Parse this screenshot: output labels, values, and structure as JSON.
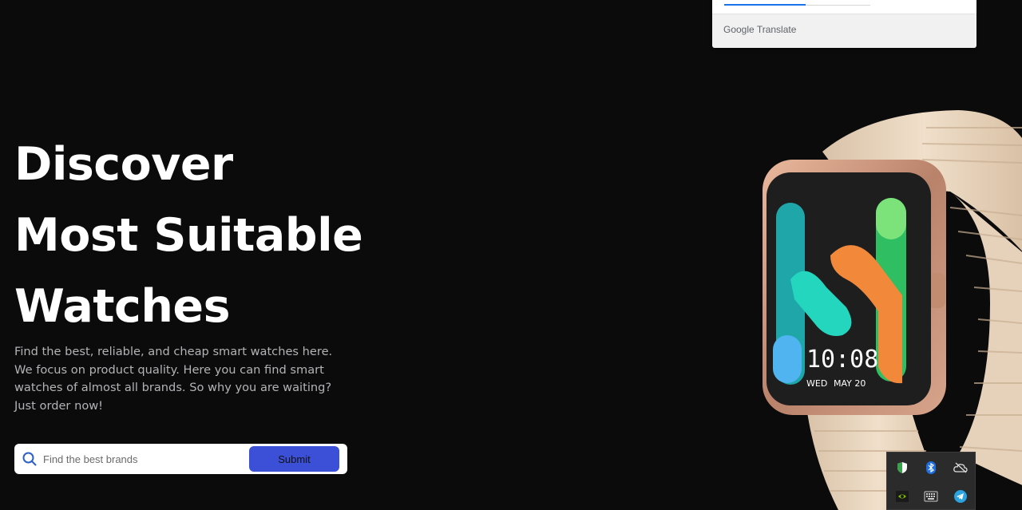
{
  "translate_popup": {
    "brand": "Google Translate",
    "progress": 0.56
  },
  "hero": {
    "title_lines": [
      "Discover",
      "Most Suitable",
      "Watches"
    ],
    "description": "Find the best, reliable, and cheap smart watches here. We focus on product quality. Here you can find smart watches of almost all brands. So why you are waiting? Just order now!"
  },
  "search": {
    "placeholder": "Find the best brands",
    "value": "",
    "submit_label": "Submit"
  },
  "watch": {
    "time": "10:08",
    "day": "WED",
    "date": "MAY 20",
    "colors": {
      "case": "#c9957a",
      "band": "#ecd9c2",
      "screen": "#1e1e1f"
    }
  },
  "tray": {
    "icons": [
      "security-shield-icon",
      "bluetooth-icon",
      "cloud-offline-icon",
      "nvidia-icon",
      "keyboard-icon",
      "telegram-icon"
    ]
  },
  "colors": {
    "background": "#0c0b0c",
    "accent": "#3b50d6",
    "text_muted": "#b3b3b6"
  }
}
